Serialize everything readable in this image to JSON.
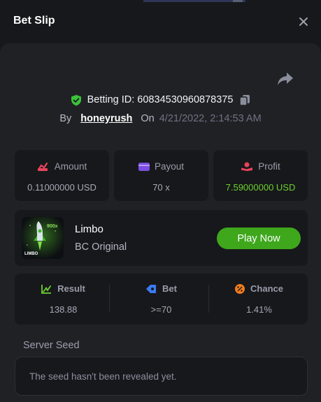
{
  "header": {
    "title": "Bet Slip"
  },
  "bet": {
    "id_label": "Betting ID: 60834530960878375",
    "by_label": "By",
    "user": "honeyrush",
    "on_label": "On",
    "date": "4/21/2022, 2:14:53 AM"
  },
  "stats": {
    "amount": {
      "label": "Amount",
      "value": "0.11000000 USD"
    },
    "payout": {
      "label": "Payout",
      "value": "70 x"
    },
    "profit": {
      "label": "Profit",
      "value": "7.59000000 USD"
    }
  },
  "game": {
    "name": "Limbo",
    "subtitle": "BC Original",
    "play_label": "Play Now",
    "thumb_text": "LIMBO",
    "thumb_badge": "900x"
  },
  "result": {
    "result": {
      "label": "Result",
      "value": "138.88"
    },
    "bet": {
      "label": "Bet",
      "value": ">=70"
    },
    "chance": {
      "label": "Chance",
      "value": "1.41%"
    }
  },
  "seed": {
    "label": "Server Seed",
    "text": "The seed hasn't been revealed yet."
  },
  "colors": {
    "accent_green": "#3ea71c",
    "profit_green": "#6bd12f",
    "amount_icon": "#e8435b",
    "payout_icon": "#7a4ee0",
    "bet_icon": "#3a7bf2",
    "chance_icon": "#f07c1c"
  },
  "icons": {
    "close": "close-icon",
    "share": "share-icon",
    "shield": "shield-check-icon",
    "copy": "copy-icon",
    "amount": "amount-icon",
    "payout": "wallet-icon",
    "profit": "profit-icon",
    "result": "chart-icon",
    "bet": "bet-tag-icon",
    "chance": "percent-icon"
  }
}
